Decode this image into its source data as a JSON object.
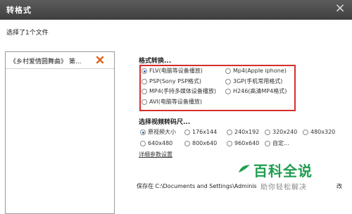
{
  "window": {
    "title": "转格式",
    "close_glyph": "×"
  },
  "selection": {
    "text": "选择了1个文件"
  },
  "files": [
    {
      "name": "《乡村爱情圆舞曲》 第...",
      "remove_icon": "remove-x-icon"
    }
  ],
  "format_section": {
    "label": "格式转换...",
    "options": [
      {
        "label": "FLV(电脑等设备播放)",
        "checked": true
      },
      {
        "label": "Mp4(Apple iphone)",
        "checked": false
      },
      {
        "label": "PSP(Sony PSP格式)",
        "checked": false
      },
      {
        "label": "3GP(手机常用格式)",
        "checked": false
      },
      {
        "label": "MP4(手持多媒体设备播放)",
        "checked": false
      },
      {
        "label": "H246(高清MP4格式)",
        "checked": false
      },
      {
        "label": "AVI(电脑等设备播放)",
        "checked": false
      }
    ],
    "highlight_color": "#d42f2f"
  },
  "size_section": {
    "label": "选择视频转码尺...",
    "options": [
      {
        "label": "原视频大小",
        "checked": true
      },
      {
        "label": "176x144",
        "checked": false
      },
      {
        "label": "240x192",
        "checked": false
      },
      {
        "label": "320x240",
        "checked": false
      },
      {
        "label": "480x320",
        "checked": false
      },
      {
        "label": "640x480",
        "checked": false
      },
      {
        "label": "800x640",
        "checked": false
      },
      {
        "label": "960x640",
        "checked": false
      },
      {
        "label": "自定...",
        "checked": false
      }
    ],
    "detail_link": "详细参数设置"
  },
  "save": {
    "text": "保存在 C:\\Documents and Settings\\Adminis",
    "tail": "改"
  },
  "watermark": {
    "title": "百科全说",
    "subtitle": "助你轻松解决",
    "color": "#1e9e4f"
  }
}
